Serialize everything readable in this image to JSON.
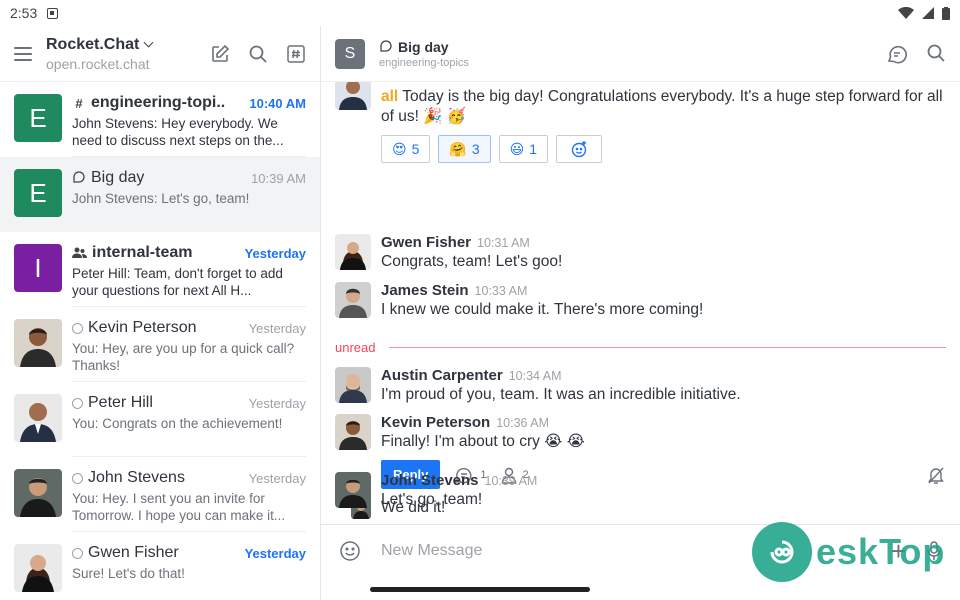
{
  "status": {
    "time": "2:53"
  },
  "workspace": {
    "name": "Rocket.Chat",
    "host": "open.rocket.chat"
  },
  "colors": {
    "accent": "#1d74f5",
    "unread": "#f5455c",
    "mention": "#f5a623",
    "avatar_green": "#1f8a5e",
    "avatar_purple": "#7b1fa2"
  },
  "rooms": [
    {
      "type": "channel",
      "icon": "hash-icon",
      "avatar": "E",
      "name": "engineering-topi..",
      "time": "10:40 AM",
      "time_highlight": true,
      "last": "John Stevens: Hey everybody. We need to discuss next steps on the...",
      "bold": true
    },
    {
      "type": "discussion",
      "icon": "discussion-icon",
      "avatar": "E",
      "name": "Big day",
      "time": "10:39 AM",
      "time_highlight": false,
      "last": "John Stevens: Let's go, team!",
      "bold": false
    },
    {
      "type": "team",
      "icon": "team-icon",
      "avatar": "I",
      "name": "internal-team",
      "time": "Yesterday",
      "time_highlight": true,
      "last": "Peter Hill: Team, don't forget to add your questions for next All H...",
      "bold": true
    },
    {
      "type": "dm",
      "icon": "status-offline-icon",
      "name": "Kevin Peterson",
      "time": "Yesterday",
      "time_highlight": false,
      "last": "You: Hey, are you up for a quick call? Thanks!",
      "bold": false
    },
    {
      "type": "dm",
      "icon": "status-offline-icon",
      "name": "Peter Hill",
      "time": "Yesterday",
      "time_highlight": false,
      "last": "You: Congrats on the achievement!",
      "bold": false
    },
    {
      "type": "dm",
      "icon": "status-offline-icon",
      "name": "John Stevens",
      "time": "Yesterday",
      "time_highlight": false,
      "last": "You: Hey. I sent you an invite for Tomorrow. I hope you can make it...",
      "bold": false
    },
    {
      "type": "dm",
      "icon": "status-offline-icon",
      "name": "Gwen Fisher",
      "time": "Yesterday",
      "time_highlight": true,
      "last": "Sure! Let's do that!",
      "bold": false
    }
  ],
  "room_header": {
    "avatar": "S",
    "title": "Big day",
    "subtitle": "engineering-topics"
  },
  "messages": {
    "first": {
      "mention": "all",
      "text": " Today is the big day! Congratulations everybody. It's a huge step forward for all of us! 🎉 🥳"
    },
    "reactions": [
      {
        "emoji": "😍",
        "count": "5",
        "mine": false
      },
      {
        "emoji": "🤗",
        "count": "3",
        "mine": true
      },
      {
        "emoji": "😃",
        "count": "1",
        "mine": false
      }
    ],
    "gwen": {
      "user": "Gwen Fisher",
      "time": "10:31 AM",
      "text": "Congrats, team! Let's goo!"
    },
    "james": {
      "user": "James Stein",
      "time": "10:33 AM",
      "text": "I knew we could make it. There's more coming!"
    },
    "unread_label": "unread",
    "austin": {
      "user": "Austin Carpenter",
      "time": "10:34 AM",
      "text": "I'm proud of you, team. It was an incredible initiative."
    },
    "kevin": {
      "user": "Kevin Peterson",
      "time": "10:36 AM",
      "text": "Finally! I'm about to cry 😭 😭"
    },
    "thread": {
      "reply_label": "Reply",
      "replies": "1",
      "followers": "2"
    },
    "wedid": {
      "text": "We did it!"
    },
    "john": {
      "user": "John Stevens",
      "time": "10:39 AM",
      "text": "Let's go, team!"
    }
  },
  "composer": {
    "placeholder": "New Message"
  },
  "watermark": {
    "text": "eskTop"
  }
}
